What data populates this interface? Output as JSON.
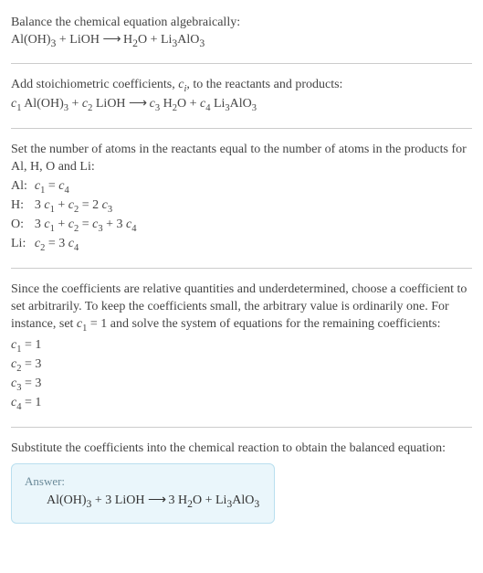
{
  "intro": "Balance the chemical equation algebraically:",
  "eq_main": "Al(OH)<sub>3</sub> + LiOH  <span class='arrow'>⟶</span>  H<sub>2</sub>O + Li<sub>3</sub>AlO<sub>3</sub>",
  "coef_text_a": "Add stoichiometric coefficients, ",
  "coef_var": "c",
  "coef_var_idx": "i",
  "coef_text_b": ", to the reactants and products:",
  "eq_coef": "<span class='i'>c</span><span class='sub'>1</span> Al(OH)<span class='sub'>3</span> + <span class='i'>c</span><span class='sub'>2</span> LiOH  <span class='arrow'>⟶</span>  <span class='i'>c</span><span class='sub'>3</span> H<span class='sub'>2</span>O + <span class='i'>c</span><span class='sub'>4</span> Li<span class='sub'>3</span>AlO<span class='sub'>3</span>",
  "atoms_intro": "Set the number of atoms in the reactants equal to the number of atoms in the products for Al, H, O and Li:",
  "atom_rows": [
    {
      "el": "Al:",
      "eq": "<span class='i'>c</span><span class='sub'>1</span> = <span class='i'>c</span><span class='sub'>4</span>"
    },
    {
      "el": "H:",
      "eq": "3 <span class='i'>c</span><span class='sub'>1</span> + <span class='i'>c</span><span class='sub'>2</span> = 2 <span class='i'>c</span><span class='sub'>3</span>"
    },
    {
      "el": "O:",
      "eq": "3 <span class='i'>c</span><span class='sub'>1</span> + <span class='i'>c</span><span class='sub'>2</span> = <span class='i'>c</span><span class='sub'>3</span> + 3 <span class='i'>c</span><span class='sub'>4</span>"
    },
    {
      "el": "Li:",
      "eq": "<span class='i'>c</span><span class='sub'>2</span> = 3 <span class='i'>c</span><span class='sub'>4</span>"
    }
  ],
  "solve_intro": "Since the coefficients are relative quantities and underdetermined, choose a coefficient to set arbitrarily. To keep the coefficients small, the arbitrary value is ordinarily one. For instance, set <span class='i'>c</span><span class='sub'>1</span> = 1 and solve the system of equations for the remaining coefficients:",
  "solutions": [
    "<span class='i'>c</span><span class='sub'>1</span> = 1",
    "<span class='i'>c</span><span class='sub'>2</span> = 3",
    "<span class='i'>c</span><span class='sub'>3</span> = 3",
    "<span class='i'>c</span><span class='sub'>4</span> = 1"
  ],
  "subst_text": "Substitute the coefficients into the chemical reaction to obtain the balanced equation:",
  "answer_label": "Answer:",
  "answer_eq": "Al(OH)<sub>3</sub> + 3 LiOH  <span class='arrow'>⟶</span>  3 H<sub>2</sub>O + Li<sub>3</sub>AlO<sub>3</sub>"
}
